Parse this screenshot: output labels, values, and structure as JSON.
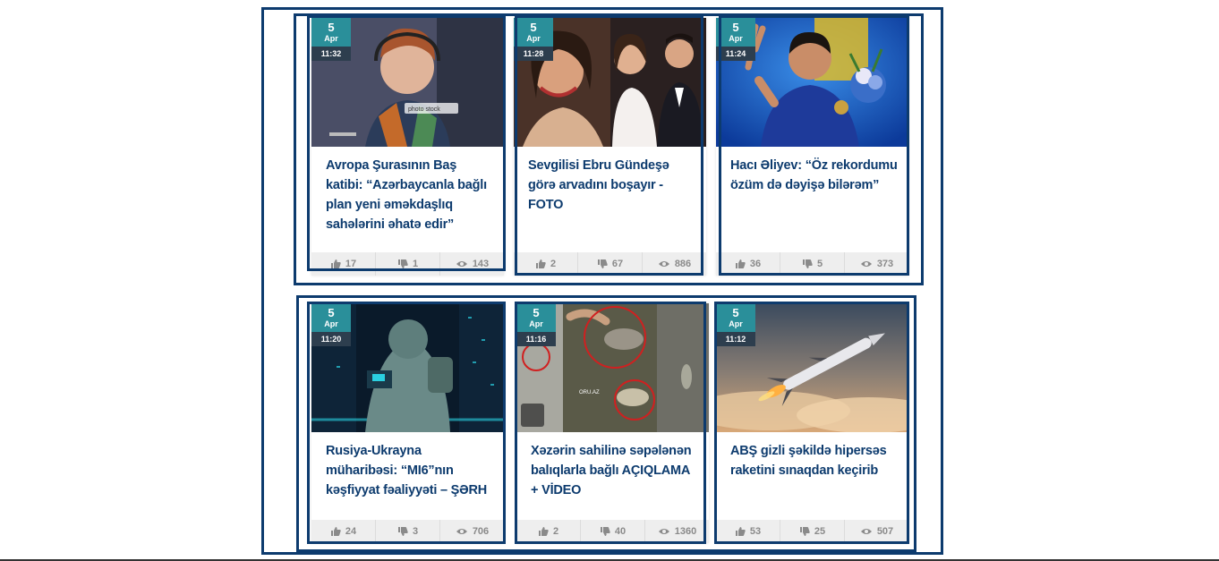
{
  "cards": [
    {
      "day": "5",
      "month": "Apr",
      "time": "11:32",
      "title": "Avropa Şurasının Baş katibi: “Azərbaycanla bağlı plan yeni əməkdaşlıq sahələrini əhatə edir”",
      "likes": "17",
      "dislikes": "1",
      "views": "143",
      "image_watermark": "photo stock"
    },
    {
      "day": "5",
      "month": "Apr",
      "time": "11:28",
      "title": "Sevgilisi Ebru Gündeşə görə arvadını boşayır - FOTO",
      "likes": "2",
      "dislikes": "67",
      "views": "886"
    },
    {
      "day": "5",
      "month": "Apr",
      "time": "11:24",
      "title": "Hacı Əliyev: “Öz rekordumu özüm də dəyişə bilərəm”",
      "likes": "36",
      "dislikes": "5",
      "views": "373"
    },
    {
      "day": "5",
      "month": "Apr",
      "time": "11:20",
      "title": "Rusiya-Ukrayna müharibəsi: “MI6”nın kəşfiyyat fəaliyyəti – ŞƏRH",
      "likes": "24",
      "dislikes": "3",
      "views": "706"
    },
    {
      "day": "5",
      "month": "Apr",
      "time": "11:16",
      "title": "Xəzərin sahilinə səpələnən balıqlarla bağlı AÇIQLAMA + VİDEO",
      "likes": "2",
      "dislikes": "40",
      "views": "1360",
      "image_watermark": "ORU.AZ"
    },
    {
      "day": "5",
      "month": "Apr",
      "time": "11:12",
      "title": "ABŞ gizli şəkildə hipersəs raketini sınaqdan keçirib",
      "likes": "53",
      "dislikes": "25",
      "views": "507"
    }
  ],
  "colors": {
    "title": "#0d3b6e",
    "date_badge": "#2a8f9a",
    "time_badge": "#2d3e4e",
    "frame": "#0d3b6e",
    "stats_bg": "#eeeeee",
    "stats_text": "#8a8a8a"
  },
  "icons": {
    "like": "thumbs-up-icon",
    "dislike": "thumbs-down-icon",
    "views": "eye-icon"
  }
}
